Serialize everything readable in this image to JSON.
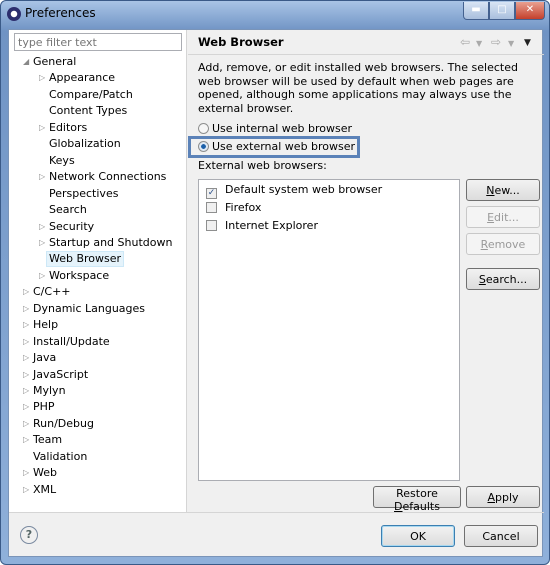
{
  "window": {
    "title": "Preferences",
    "controls": [
      "minimize",
      "maximize",
      "close"
    ]
  },
  "filter": {
    "placeholder": "type filter text"
  },
  "tree": [
    {
      "label": "General",
      "level": 0,
      "expanded": true
    },
    {
      "label": "Appearance",
      "level": 1,
      "expandable": true
    },
    {
      "label": "Compare/Patch",
      "level": 1
    },
    {
      "label": "Content Types",
      "level": 1
    },
    {
      "label": "Editors",
      "level": 1,
      "expandable": true
    },
    {
      "label": "Globalization",
      "level": 1
    },
    {
      "label": "Keys",
      "level": 1
    },
    {
      "label": "Network Connections",
      "level": 1,
      "expandable": true
    },
    {
      "label": "Perspectives",
      "level": 1
    },
    {
      "label": "Search",
      "level": 1
    },
    {
      "label": "Security",
      "level": 1,
      "expandable": true
    },
    {
      "label": "Startup and Shutdown",
      "level": 1,
      "expandable": true
    },
    {
      "label": "Web Browser",
      "level": 1,
      "selected": true
    },
    {
      "label": "Workspace",
      "level": 1,
      "expandable": true
    },
    {
      "label": "C/C++",
      "level": 0,
      "expandable": true
    },
    {
      "label": "Dynamic Languages",
      "level": 0,
      "expandable": true
    },
    {
      "label": "Help",
      "level": 0,
      "expandable": true
    },
    {
      "label": "Install/Update",
      "level": 0,
      "expandable": true
    },
    {
      "label": "Java",
      "level": 0,
      "expandable": true
    },
    {
      "label": "JavaScript",
      "level": 0,
      "expandable": true
    },
    {
      "label": "Mylyn",
      "level": 0,
      "expandable": true
    },
    {
      "label": "PHP",
      "level": 0,
      "expandable": true
    },
    {
      "label": "Run/Debug",
      "level": 0,
      "expandable": true
    },
    {
      "label": "Team",
      "level": 0,
      "expandable": true
    },
    {
      "label": "Validation",
      "level": 0
    },
    {
      "label": "Web",
      "level": 0,
      "expandable": true
    },
    {
      "label": "XML",
      "level": 0,
      "expandable": true
    }
  ],
  "page": {
    "title": "Web Browser",
    "description": "Add, remove, or edit installed web browsers. The selected web browser will be used by default when web pages are opened, although some applications may always use the external browser.",
    "radio_internal": "Use internal web browser",
    "radio_external": "Use external web browser",
    "selected_radio": "external",
    "list_label": "External web browsers:",
    "browsers": [
      {
        "label": "Default system web browser",
        "checked": true
      },
      {
        "label": "Firefox",
        "checked": false
      },
      {
        "label": "Internet Explorer",
        "checked": false
      }
    ],
    "buttons": {
      "new": "New...",
      "edit": "Edit...",
      "remove": "Remove",
      "search": "Search...",
      "restore": "Restore Defaults",
      "apply": "Apply"
    }
  },
  "footer": {
    "ok": "OK",
    "cancel": "Cancel"
  },
  "colors": {
    "highlight": "#5b82b8",
    "selection": "#e5f3fb"
  }
}
